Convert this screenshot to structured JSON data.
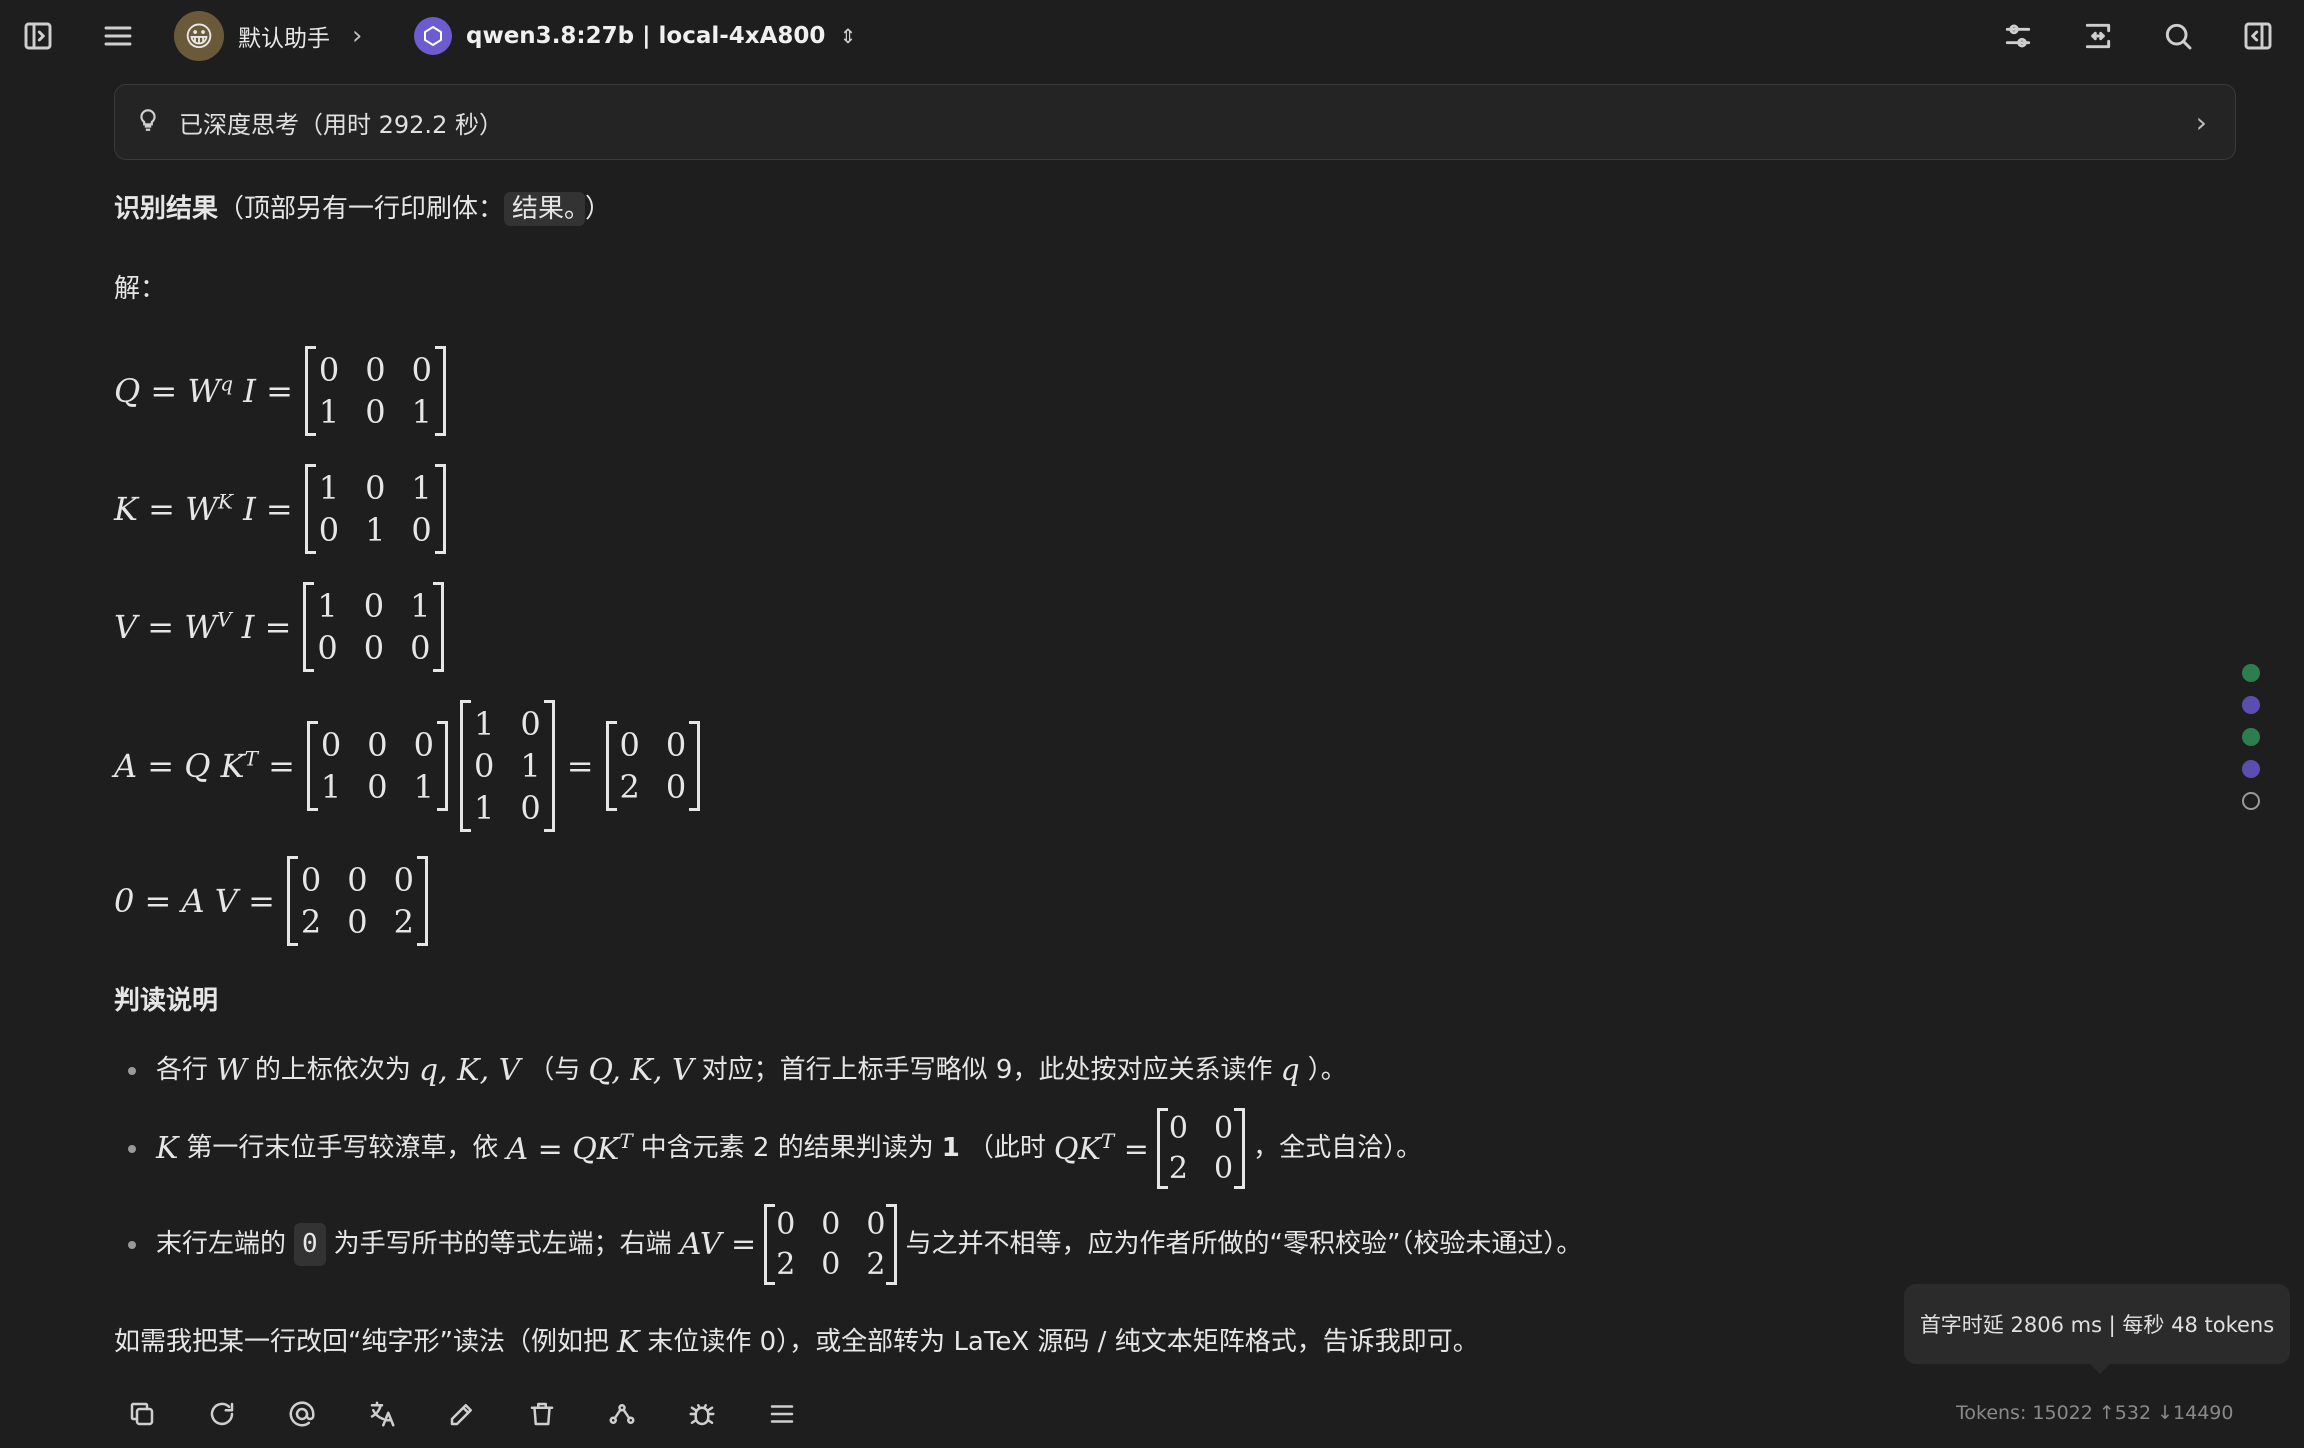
{
  "header": {
    "assistant_name": "默认助手",
    "assistant_emoji": "😀",
    "model_name": "qwen3.8:27b | local-4xA800"
  },
  "thinking": {
    "label": "已深度思考（用时 292.2 秒）"
  },
  "message": {
    "result_title": "识别结果",
    "result_note_prefix": "（顶部另有一行印刷体：",
    "result_note_code": "结果。",
    "result_note_suffix": "）",
    "solution_label": "解：",
    "equations": [
      {
        "lhs": "Q = W",
        "sup": "q",
        "mid": " I =",
        "matrix": [
          [
            "0",
            "0",
            "0"
          ],
          [
            "1",
            "0",
            "1"
          ]
        ]
      },
      {
        "lhs": "K = W",
        "sup": "K",
        "mid": " I =",
        "matrix": [
          [
            "1",
            "0",
            "1"
          ],
          [
            "0",
            "1",
            "0"
          ]
        ]
      },
      {
        "lhs": "V = W",
        "sup": "V",
        "mid": " I =",
        "matrix": [
          [
            "1",
            "0",
            "1"
          ],
          [
            "0",
            "0",
            "0"
          ]
        ]
      }
    ],
    "eq_A": {
      "lhs": "A = Q K",
      "sup": "T",
      "mid": " =",
      "m1": [
        [
          "0",
          "0",
          "0"
        ],
        [
          "1",
          "0",
          "1"
        ]
      ],
      "m2": [
        [
          "1",
          "0"
        ],
        [
          "0",
          "1"
        ],
        [
          "1",
          "0"
        ]
      ],
      "eq": "=",
      "m3": [
        [
          "0",
          "0"
        ],
        [
          "2",
          "0"
        ]
      ]
    },
    "eq_zero": {
      "lhs": "0 = A V =",
      "matrix": [
        [
          "0",
          "0",
          "0"
        ],
        [
          "2",
          "0",
          "2"
        ]
      ]
    },
    "notes_title": "判读说明",
    "bullet1": {
      "t1": "各行",
      "m1": "W",
      "t2": "的上标依次为",
      "m2": "q, K, V",
      "t3": "（与",
      "m3": "Q, K, V",
      "t4": "对应；首行上标手写略似 9，此处按对应关系读作",
      "m4": "q",
      "t5": "）。"
    },
    "bullet2": {
      "m1": "K",
      "t1": "第一行末位手写较潦草，依",
      "m2": "A = QK",
      "sup": "T",
      "t2": "中含元素 2 的结果判读为",
      "bold": "1",
      "t3": "（此时",
      "m3": "QK",
      "sup2": "T",
      "m3b": " =",
      "matrix": [
        [
          "0",
          "0"
        ],
        [
          "2",
          "0"
        ]
      ],
      "t4": "，全式自洽）。"
    },
    "bullet3": {
      "t1": "末行左端的",
      "code": "0",
      "t2": "为手写所书的等式左端；右端",
      "m1": "AV =",
      "matrix": [
        [
          "0",
          "0",
          "0"
        ],
        [
          "2",
          "0",
          "2"
        ]
      ],
      "t3": "与之并不相等，应为作者所做的“零积校验”（校验未通过）。"
    },
    "closing": {
      "t1": "如需我把某一行改回“纯字形”读法（例如把",
      "m1": "K",
      "t2": "末位读作 0），或全部转为 LaTeX 源码 / 纯文本矩阵格式，告诉我即可。"
    }
  },
  "stats": {
    "tooltip": "首字时延 2806 ms | 每秒 48 tokens",
    "tokens": "Tokens: 15022 ↑532 ↓14490"
  },
  "colors": {
    "background": "#1e1e1e",
    "model_logo": "#6d5bd0",
    "minimap_green": "#2e7d4f",
    "minimap_purple": "#5a4fb0"
  }
}
